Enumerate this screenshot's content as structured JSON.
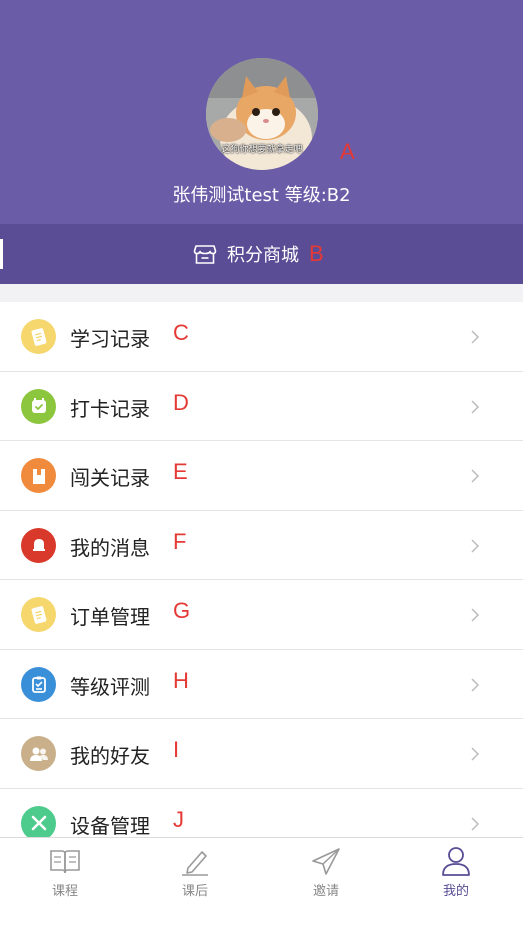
{
  "profile": {
    "avatar_caption": "这狗你想要就拿走吧",
    "name_level": "张伟测试test  等级:B2",
    "marker": "A"
  },
  "mall": {
    "label": "积分商城",
    "marker": "B"
  },
  "menu": [
    {
      "label": "学习记录",
      "marker": "C",
      "icon": "notebook-icon",
      "color": "#f5d76e"
    },
    {
      "label": "打卡记录",
      "marker": "D",
      "icon": "calendar-check-icon",
      "color": "#8cc63f"
    },
    {
      "label": "闯关记录",
      "marker": "E",
      "icon": "door-icon",
      "color": "#f08a3c"
    },
    {
      "label": "我的消息",
      "marker": "F",
      "icon": "bell-icon",
      "color": "#d9392b"
    },
    {
      "label": "订单管理",
      "marker": "G",
      "icon": "notebook-icon",
      "color": "#f5d76e"
    },
    {
      "label": "等级评测",
      "marker": "H",
      "icon": "clipboard-icon",
      "color": "#3a8fd9"
    },
    {
      "label": "我的好友",
      "marker": "I",
      "icon": "friends-icon",
      "color": "#c9b08a"
    },
    {
      "label": "设备管理",
      "marker": "J",
      "icon": "tools-icon",
      "color": "#4ccb8c"
    }
  ],
  "tabs": [
    {
      "label": "课程",
      "icon": "book-icon"
    },
    {
      "label": "课后",
      "icon": "pencil-icon"
    },
    {
      "label": "邀请",
      "icon": "paper-plane-icon"
    },
    {
      "label": "我的",
      "icon": "user-icon",
      "active": true
    }
  ],
  "colors": {
    "header": "#6b5ca8",
    "mall_bar": "#5a4d95",
    "marker": "#e53935"
  }
}
